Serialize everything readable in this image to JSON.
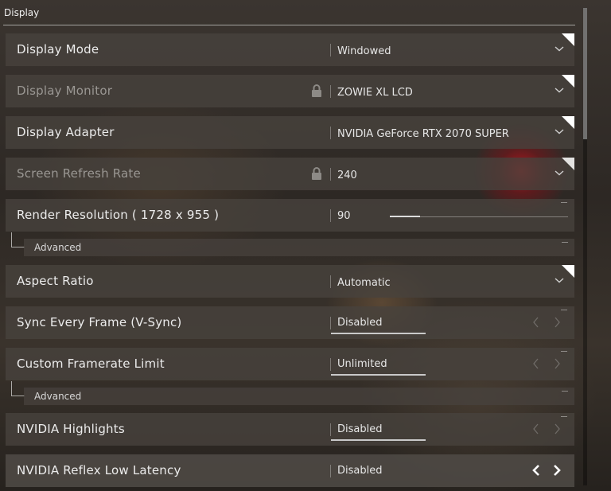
{
  "section": {
    "title": "Display"
  },
  "rows": {
    "display_mode": {
      "label": "Display Mode",
      "value": "Windowed"
    },
    "display_monitor": {
      "label": "Display Monitor",
      "value": "ZOWIE XL LCD"
    },
    "display_adapter": {
      "label": "Display Adapter",
      "value": "NVIDIA GeForce RTX 2070 SUPER"
    },
    "refresh_rate": {
      "label": "Screen Refresh Rate",
      "value": "240"
    },
    "render_resolution": {
      "label": "Render Resolution ( 1728 x 955 )",
      "value": "90",
      "slider_fraction": 0.17
    },
    "render_advanced": {
      "label": "Advanced"
    },
    "aspect_ratio": {
      "label": "Aspect Ratio",
      "value": "Automatic"
    },
    "vsync": {
      "label": "Sync Every Frame (V-Sync)",
      "value": "Disabled"
    },
    "framerate_limit": {
      "label": "Custom Framerate Limit",
      "value": "Unlimited"
    },
    "framerate_advanced": {
      "label": "Advanced"
    },
    "nvidia_highlights": {
      "label": "NVIDIA Highlights",
      "value": "Disabled"
    },
    "nvidia_reflex": {
      "label": "NVIDIA Reflex Low Latency",
      "value": "Disabled"
    }
  },
  "icons": {
    "chevron": "chevron-down-icon",
    "lock": "lock-icon",
    "left": "arrow-left-icon",
    "right": "arrow-right-icon"
  },
  "colors": {
    "row_bg": "#48433e",
    "accent_white": "#ffffff",
    "disabled_text": "#9a9793",
    "red_glow": "#c8141e"
  }
}
